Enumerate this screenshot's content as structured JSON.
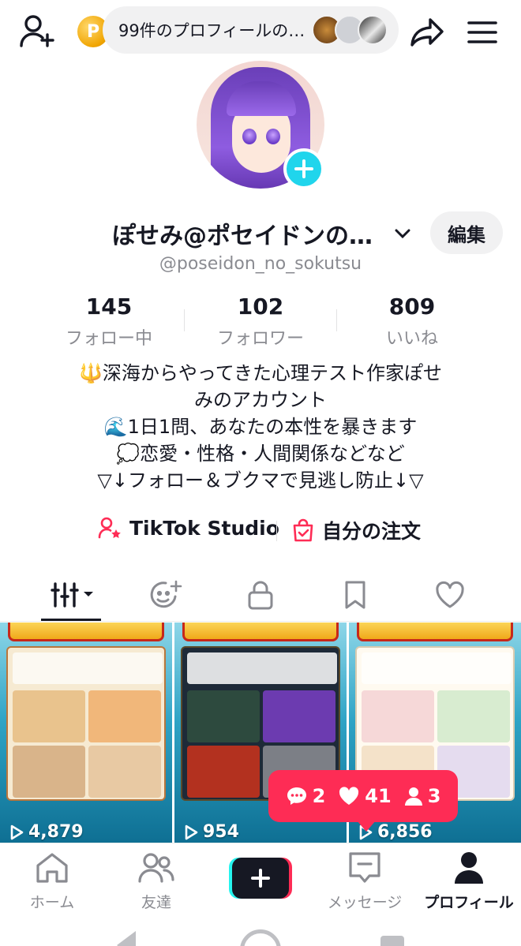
{
  "topbar": {
    "coin_glyph": "P",
    "visitors_text": "99件のプロフィールの…"
  },
  "profile": {
    "name": "ぽせみ@ポセイドンの…",
    "edit_label": "編集",
    "handle": "@poseidon_no_sokutsu"
  },
  "stats": [
    {
      "value": "145",
      "label": "フォロー中"
    },
    {
      "value": "102",
      "label": "フォロワー"
    },
    {
      "value": "809",
      "label": "いいね"
    }
  ],
  "bio": {
    "line1": "🔱深海からやってきた心理テスト作家ぽせ",
    "line2": "みのアカウント",
    "line3": "🌊1日1問、あなたの本性を暴きます",
    "line4": "💭恋愛・性格・人間関係などなど",
    "line5": "▽↓フォロー＆ブクマで見逃し防止↓▽"
  },
  "links": {
    "studio": "TikTok Studio",
    "orders": "自分の注文"
  },
  "videos": [
    {
      "views": "4,879"
    },
    {
      "views": "954"
    },
    {
      "views": "6,856"
    }
  ],
  "notification": {
    "comments": "2",
    "likes": "41",
    "followers": "3"
  },
  "nav": {
    "home": "ホーム",
    "friends": "友達",
    "messages": "メッセージ",
    "profile": "プロフィール"
  },
  "colors": {
    "accent": "#fe2c55",
    "cyan": "#20d5ec",
    "text": "#161823",
    "muted": "#8a8b91"
  }
}
